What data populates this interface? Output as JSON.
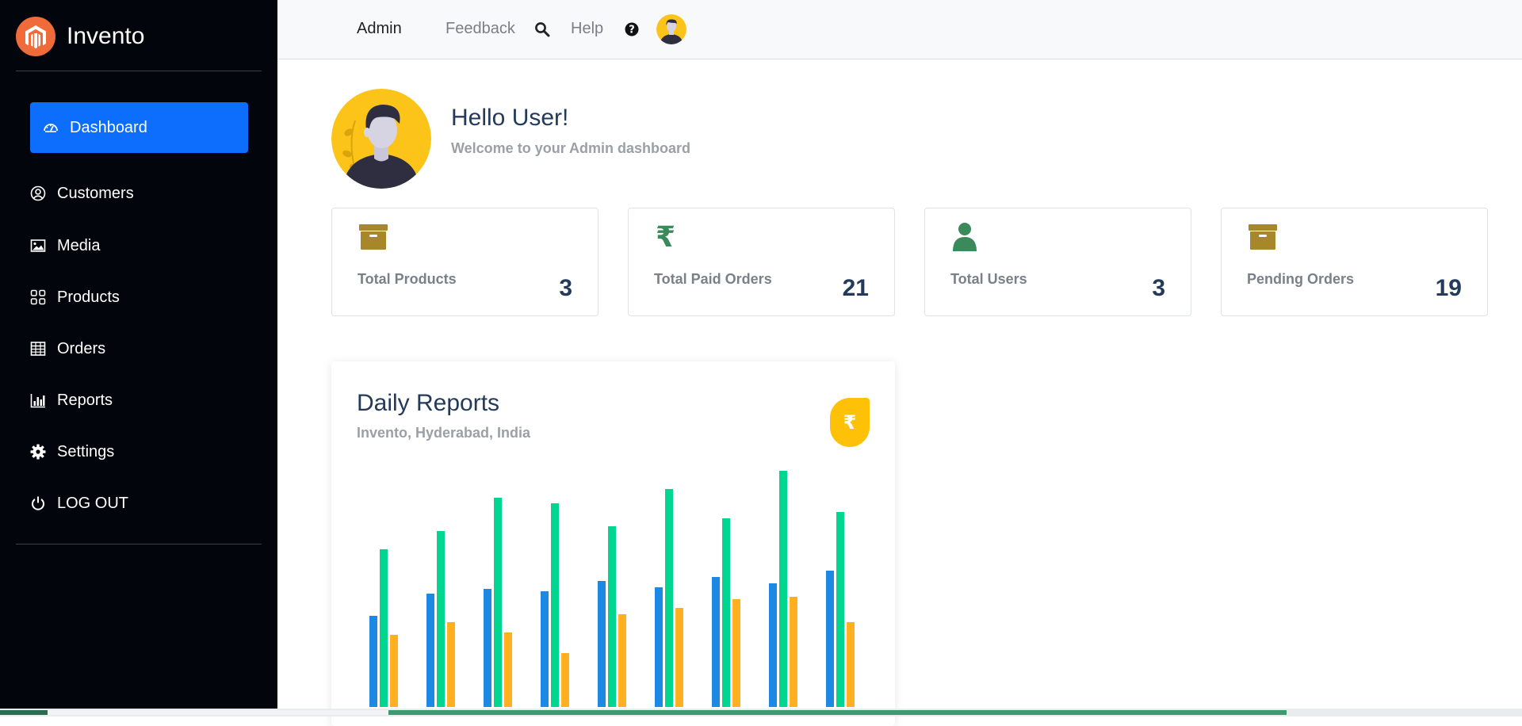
{
  "app": {
    "name": "Invento"
  },
  "sidebar": {
    "items": [
      {
        "label": "Dashboard",
        "icon": "speedometer-icon",
        "active": true
      },
      {
        "label": "Customers",
        "icon": "user-circle-icon"
      },
      {
        "label": "Media",
        "icon": "image-icon"
      },
      {
        "label": "Products",
        "icon": "grid-icon"
      },
      {
        "label": "Orders",
        "icon": "table-icon"
      },
      {
        "label": "Reports",
        "icon": "bar-chart-icon"
      },
      {
        "label": "Settings",
        "icon": "gear-icon"
      },
      {
        "label": "LOG OUT",
        "icon": "power-icon"
      }
    ]
  },
  "topbar": {
    "admin": "Admin",
    "feedback": "Feedback",
    "help": "Help"
  },
  "welcome": {
    "greeting": "Hello User!",
    "subtitle": "Welcome to your Admin dashboard"
  },
  "stats": [
    {
      "label": "Total Products",
      "value": "3",
      "icon": "archive-box-icon",
      "color": "#a8862a"
    },
    {
      "label": "Total Paid Orders",
      "value": "21",
      "icon": "rupee-icon",
      "color": "#3a8a5c"
    },
    {
      "label": "Total Users",
      "value": "3",
      "icon": "user-icon",
      "color": "#3a8a5c"
    },
    {
      "label": "Pending Orders",
      "value": "19",
      "icon": "archive-box-icon",
      "color": "#a8862a"
    }
  ],
  "report": {
    "title": "Daily Reports",
    "subtitle": "Invento, Hyderabad, India",
    "badge_symbol": "₹"
  },
  "colors": {
    "accent": "#0d6efd",
    "sidebar_bg": "#03050c",
    "brand_logo": "#ef6b3a",
    "badge": "#ffc107"
  },
  "chart_data": {
    "type": "bar",
    "title": "",
    "xlabel": "",
    "ylabel": "",
    "categories": [
      "",
      "",
      "",
      "",
      "",
      "",
      "",
      "",
      ""
    ],
    "series": [
      {
        "values": [
          115,
          143,
          149,
          146,
          159,
          151,
          164,
          156,
          172
        ],
        "color": "#1e88e5"
      },
      {
        "values": [
          199,
          222,
          264,
          257,
          228,
          275,
          238,
          298,
          246
        ],
        "color": "#00d68f"
      },
      {
        "values": [
          91,
          107,
          94,
          68,
          117,
          125,
          136,
          139,
          107
        ],
        "color": "#ffb020"
      }
    ],
    "ylim": [
      0,
      300
    ],
    "grid": false,
    "legend": "none"
  }
}
